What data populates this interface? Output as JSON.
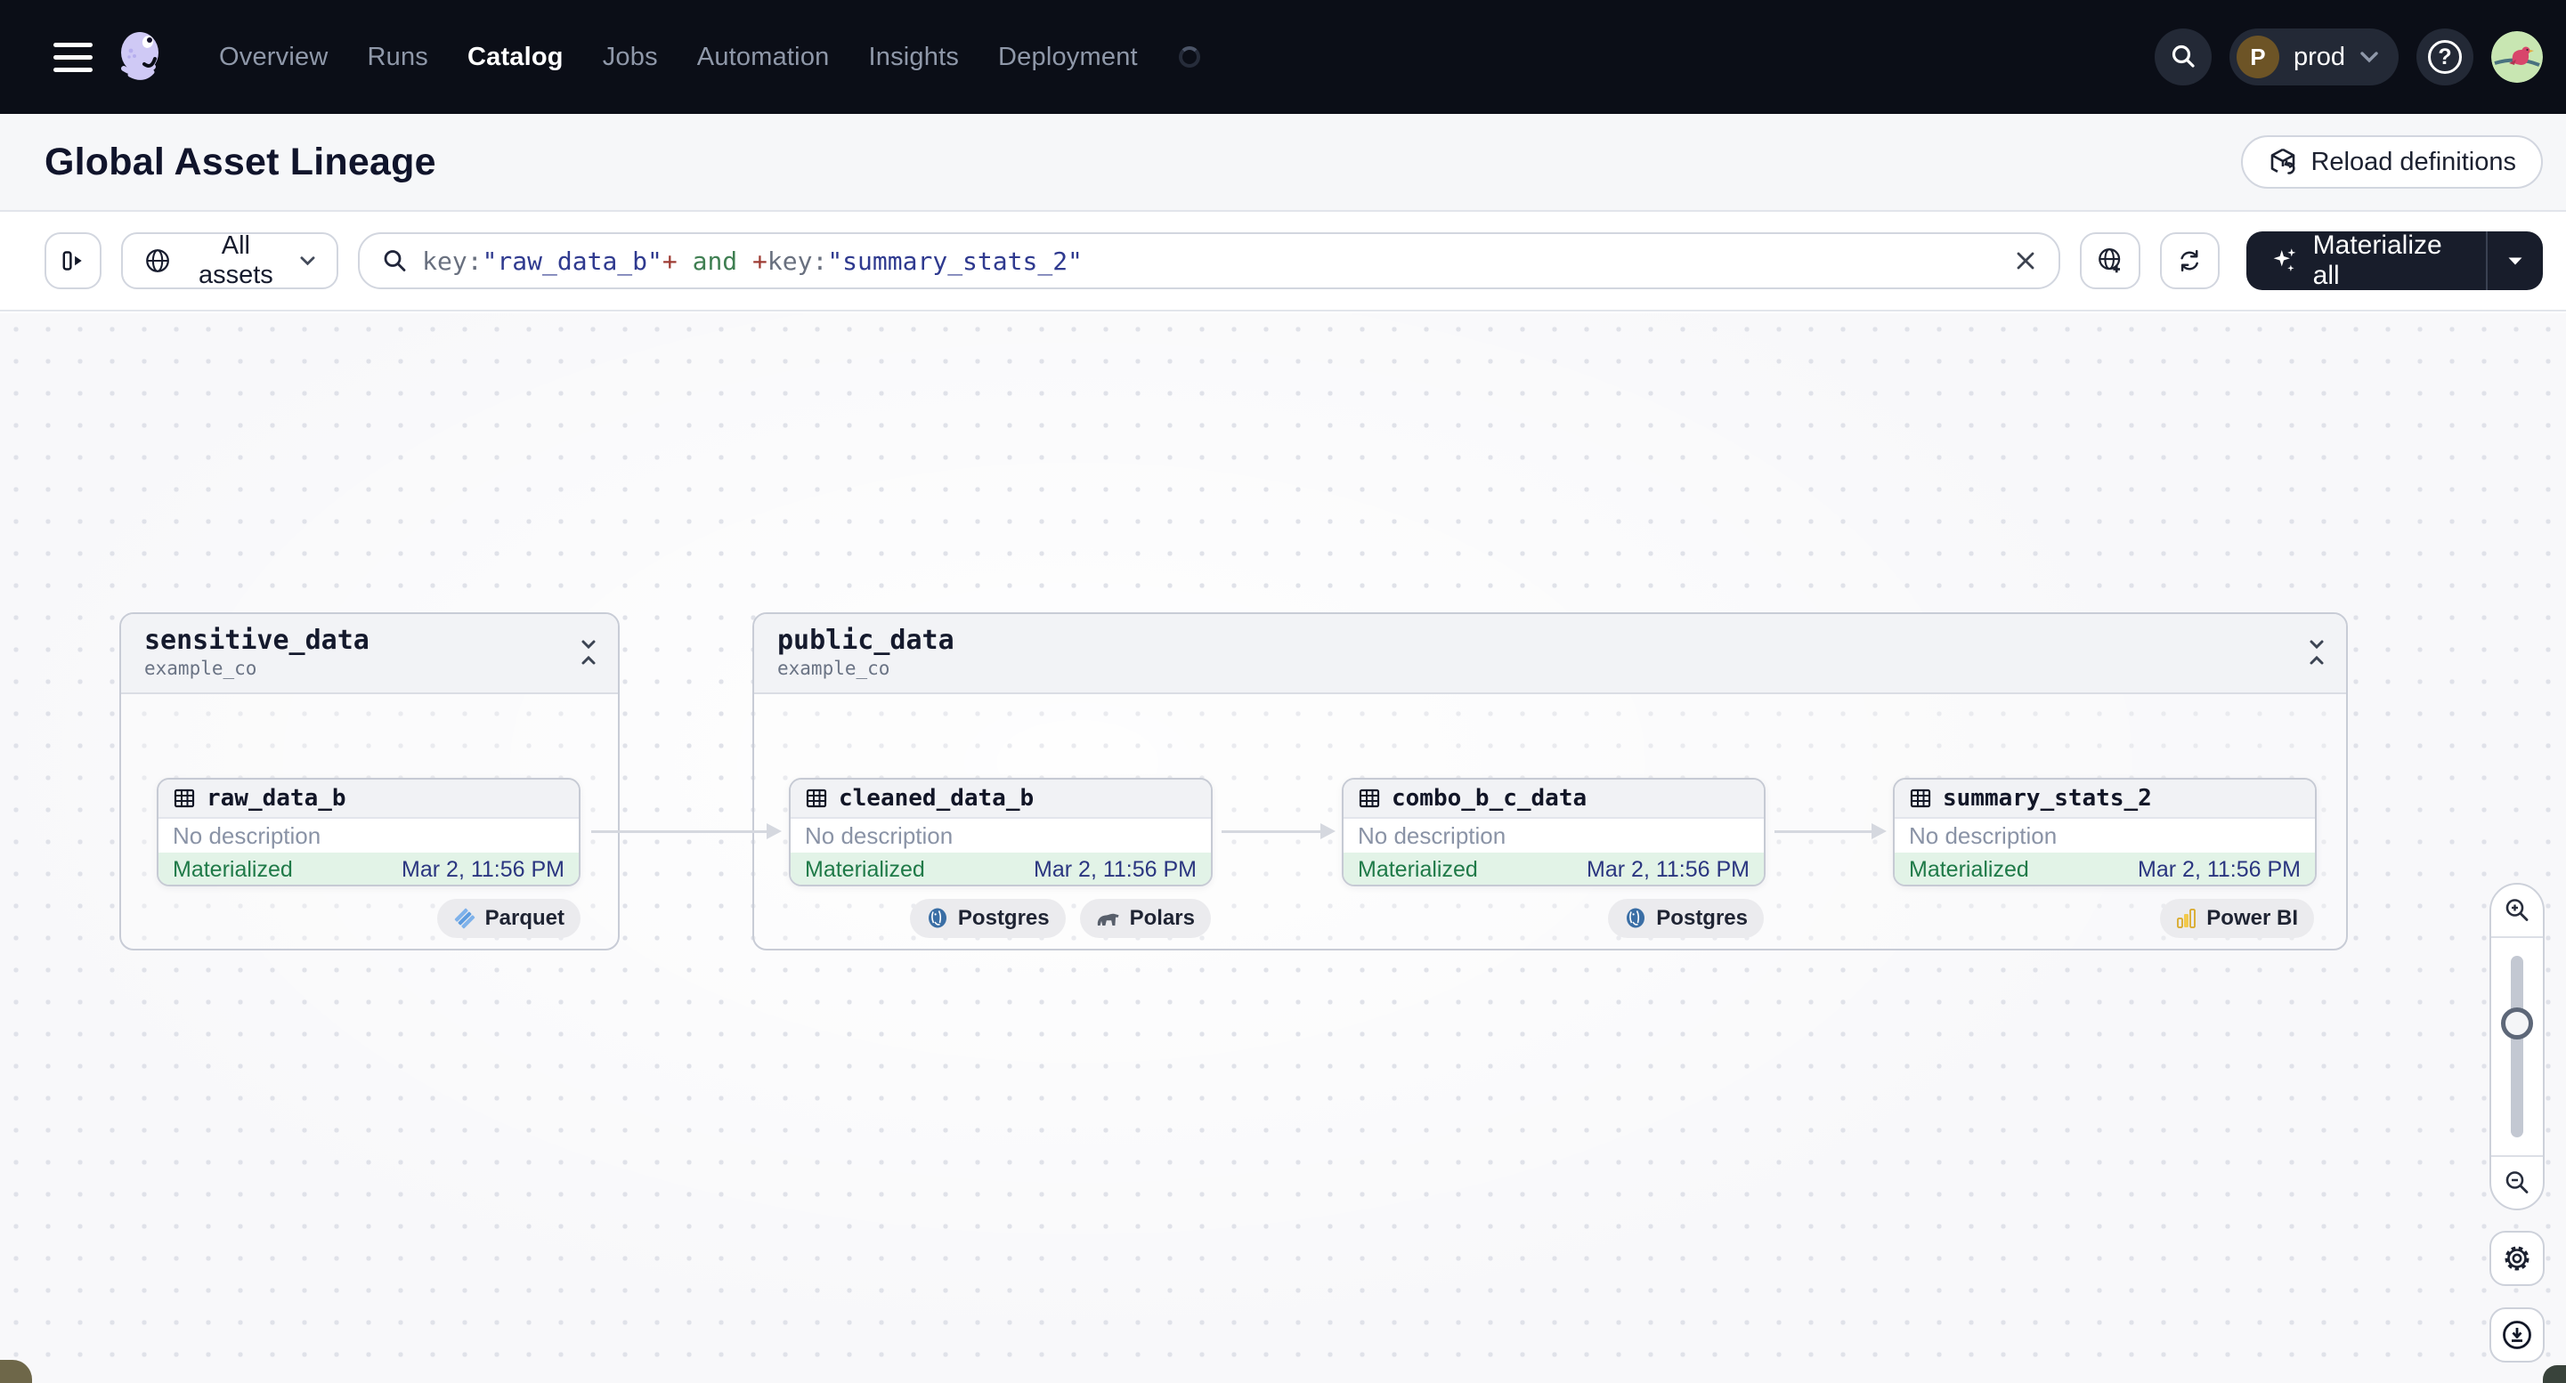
{
  "nav": {
    "items": [
      {
        "label": "Overview",
        "active": false
      },
      {
        "label": "Runs",
        "active": false
      },
      {
        "label": "Catalog",
        "active": true
      },
      {
        "label": "Jobs",
        "active": false
      },
      {
        "label": "Automation",
        "active": false
      },
      {
        "label": "Insights",
        "active": false
      },
      {
        "label": "Deployment",
        "active": false
      }
    ],
    "deployment": {
      "initial": "P",
      "name": "prod"
    },
    "help_glyph": "?"
  },
  "header": {
    "title": "Global Asset Lineage",
    "reload_label": "Reload definitions"
  },
  "toolbar": {
    "scope_label": "All assets",
    "materialize_label": "Materialize all",
    "query_segments": [
      {
        "text": "key:",
        "kind": "field"
      },
      {
        "text": "\"raw_data_b\"",
        "kind": "value"
      },
      {
        "text": "+",
        "kind": "op"
      },
      {
        "text": " and ",
        "kind": "keyword"
      },
      {
        "text": "+",
        "kind": "op"
      },
      {
        "text": "key:",
        "kind": "field"
      },
      {
        "text": "\"summary_stats_2\"",
        "kind": "value"
      }
    ]
  },
  "colors": {
    "nav_bg": "#0b0e17",
    "materialize_bg": "#181d2b",
    "status_green_text": "#1f7a48",
    "status_green_bg": "#e2f3e7",
    "timestamp_navy": "#2b3680",
    "query_value_navy": "#2f3a8f"
  },
  "graph": {
    "groups": [
      {
        "name": "sensitive_data",
        "owner": "example_co"
      },
      {
        "name": "public_data",
        "owner": "example_co"
      }
    ],
    "nodes": [
      {
        "name": "raw_data_b",
        "description": "No description",
        "status": "Materialized",
        "timestamp": "Mar 2, 11:56 PM",
        "tags": [
          {
            "label": "Parquet"
          }
        ]
      },
      {
        "name": "cleaned_data_b",
        "description": "No description",
        "status": "Materialized",
        "timestamp": "Mar 2, 11:56 PM",
        "tags": [
          {
            "label": "Postgres"
          },
          {
            "label": "Polars"
          }
        ]
      },
      {
        "name": "combo_b_c_data",
        "description": "No description",
        "status": "Materialized",
        "timestamp": "Mar 2, 11:56 PM",
        "tags": [
          {
            "label": "Postgres"
          }
        ]
      },
      {
        "name": "summary_stats_2",
        "description": "No description",
        "status": "Materialized",
        "timestamp": "Mar 2, 11:56 PM",
        "tags": [
          {
            "label": "Power BI"
          }
        ]
      }
    ]
  }
}
